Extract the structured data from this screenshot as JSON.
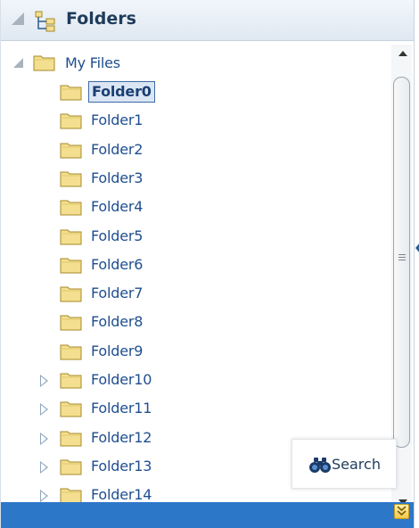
{
  "panel": {
    "title": "Folders",
    "header_icon": "folder-tree-icon"
  },
  "tree": {
    "root": {
      "label": "My Files",
      "expanded": true
    },
    "items": [
      {
        "label": "Folder0",
        "selected": true,
        "has_children": false
      },
      {
        "label": "Folder1",
        "selected": false,
        "has_children": false
      },
      {
        "label": "Folder2",
        "selected": false,
        "has_children": false
      },
      {
        "label": "Folder3",
        "selected": false,
        "has_children": false
      },
      {
        "label": "Folder4",
        "selected": false,
        "has_children": false
      },
      {
        "label": "Folder5",
        "selected": false,
        "has_children": false
      },
      {
        "label": "Folder6",
        "selected": false,
        "has_children": false
      },
      {
        "label": "Folder7",
        "selected": false,
        "has_children": false
      },
      {
        "label": "Folder8",
        "selected": false,
        "has_children": false
      },
      {
        "label": "Folder9",
        "selected": false,
        "has_children": false
      },
      {
        "label": "Folder10",
        "selected": false,
        "has_children": true
      },
      {
        "label": "Folder11",
        "selected": false,
        "has_children": true
      },
      {
        "label": "Folder12",
        "selected": false,
        "has_children": true
      },
      {
        "label": "Folder13",
        "selected": false,
        "has_children": true
      },
      {
        "label": "Folder14",
        "selected": false,
        "has_children": true
      }
    ]
  },
  "search_button": {
    "label": "Search",
    "icon": "binoculars-icon"
  },
  "footer": {
    "icon": "double-chevron-down-icon"
  },
  "colors": {
    "footer": "#2d77c9",
    "label": "#1f4e8f",
    "folder_fill": "#f3df8f",
    "folder_stroke": "#a58a2a",
    "header_title": "#1f3c5b"
  }
}
